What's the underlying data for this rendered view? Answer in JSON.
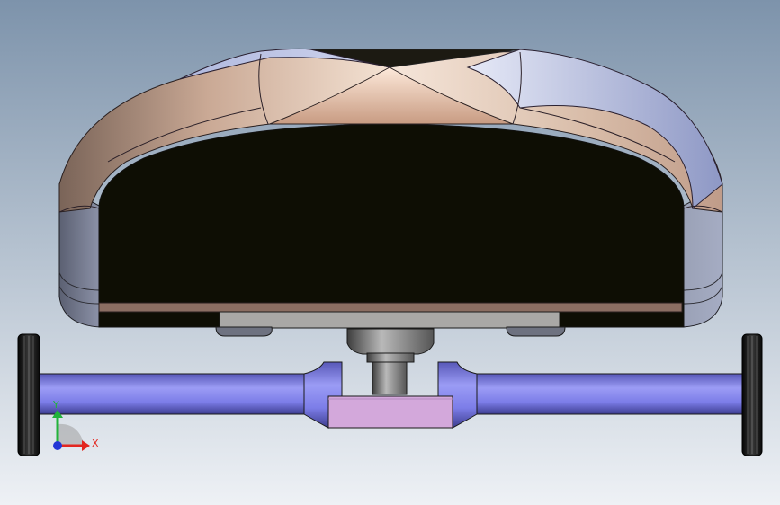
{
  "app": {
    "kind": "cad-3d-viewport"
  },
  "view": {
    "background_top": "#7d93ab",
    "background_bottom": "#eef1f5",
    "triad": {
      "x_label": "X",
      "y_label": "Y",
      "x_color": "#e3261f",
      "y_color": "#22b33a",
      "z_color": "#2336d6"
    }
  },
  "model": {
    "body_color": "#0e0e04",
    "shell_highlight": "#f3dfd0",
    "shell_mid": "#c9ad98",
    "shell_shadow": "#8b6c5e",
    "shell_blue": "#9aa3c8",
    "base_plate": "#a9a8a6",
    "stem_color": "#8a8a8a",
    "axle_color": "#7b7cf0",
    "hub_color": "#d3a8db",
    "wheel_color": "#1a1a1a"
  }
}
